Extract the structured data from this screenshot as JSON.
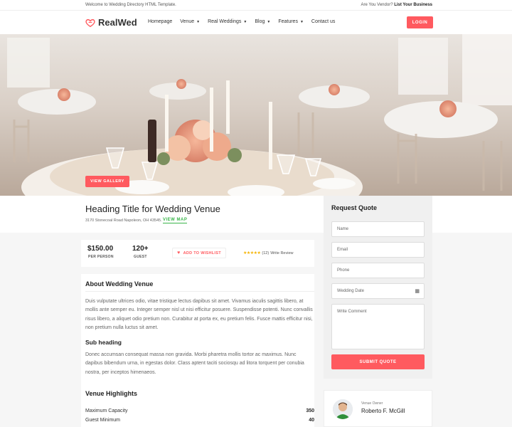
{
  "topbar": {
    "welcome": "Welcome to Wedding Directory HTML Template.",
    "vendor_question": "Are You Vendor?",
    "vendor_link": "List Your Business"
  },
  "header": {
    "logo_text": "RealWed",
    "nav": [
      {
        "label": "Homepage",
        "has_dropdown": false
      },
      {
        "label": "Venue",
        "has_dropdown": true
      },
      {
        "label": "Real Weddings",
        "has_dropdown": true
      },
      {
        "label": "Blog",
        "has_dropdown": true
      },
      {
        "label": "Features",
        "has_dropdown": true
      },
      {
        "label": "Contact us",
        "has_dropdown": false
      }
    ],
    "login_label": "LOGIN"
  },
  "hero": {
    "gallery_label": "VIEW GALLERY"
  },
  "venue": {
    "title": "Heading Title for Wedding Venue",
    "address": "3170 Stonecoal Road Napoleon, OH 43545.",
    "view_map": "VIEW MAP"
  },
  "stats": {
    "price": "$150.00",
    "price_label": "PER PERSON",
    "guests": "120+",
    "guests_label": "GUEST",
    "wishlist_label": "ADD TO WISHLIST",
    "stars": "★★★★★",
    "rating_count": "(12)",
    "review_label": "Write Review"
  },
  "about": {
    "heading": "About Wedding Venue",
    "paragraph": "Duis vulputate ultrices odio, vitae tristique lectus dapibus sit amet. Vivamus iaculis sagittis libero, at mollis ante semper eu. Integer semper nisl ut nisi efficitur posuere. Suspendisse potenti. Nunc convallis risus libero, a aliquet odio pretium non. Curabitur at porta ex, eu pretium felis. Fusce mattis efficitur nisi, non pretium nulla luctus sit amet.",
    "subheading": "Sub heading",
    "sub_paragraph": "Donec accumsan consequat massa non gravida. Morbi pharetra mollis tortor ac maximus. Nunc dapibus bibendum urna, in egestas dolor. Class aptent taciti sociosqu ad litora torquent per conubia nostra, per inceptos himenaeos."
  },
  "highlights": {
    "heading": "Venue Highlights",
    "rows": [
      {
        "label": "Maximum Capacity",
        "value": "350"
      },
      {
        "label": "Guest Minimum",
        "value": "40"
      }
    ]
  },
  "quote": {
    "title": "Request Quote",
    "name_placeholder": "Name",
    "email_placeholder": "Email",
    "phone_placeholder": "Phone",
    "date_placeholder": "Wedding Date",
    "comment_placeholder": "Write Comment",
    "submit_label": "SUBMIT QUOTE"
  },
  "owner": {
    "label": "Venue Owner",
    "name": "Roberto F. McGill"
  },
  "colors": {
    "accent": "#ff5a5f",
    "map_link": "#3ab54a",
    "star": "#f5b301"
  }
}
